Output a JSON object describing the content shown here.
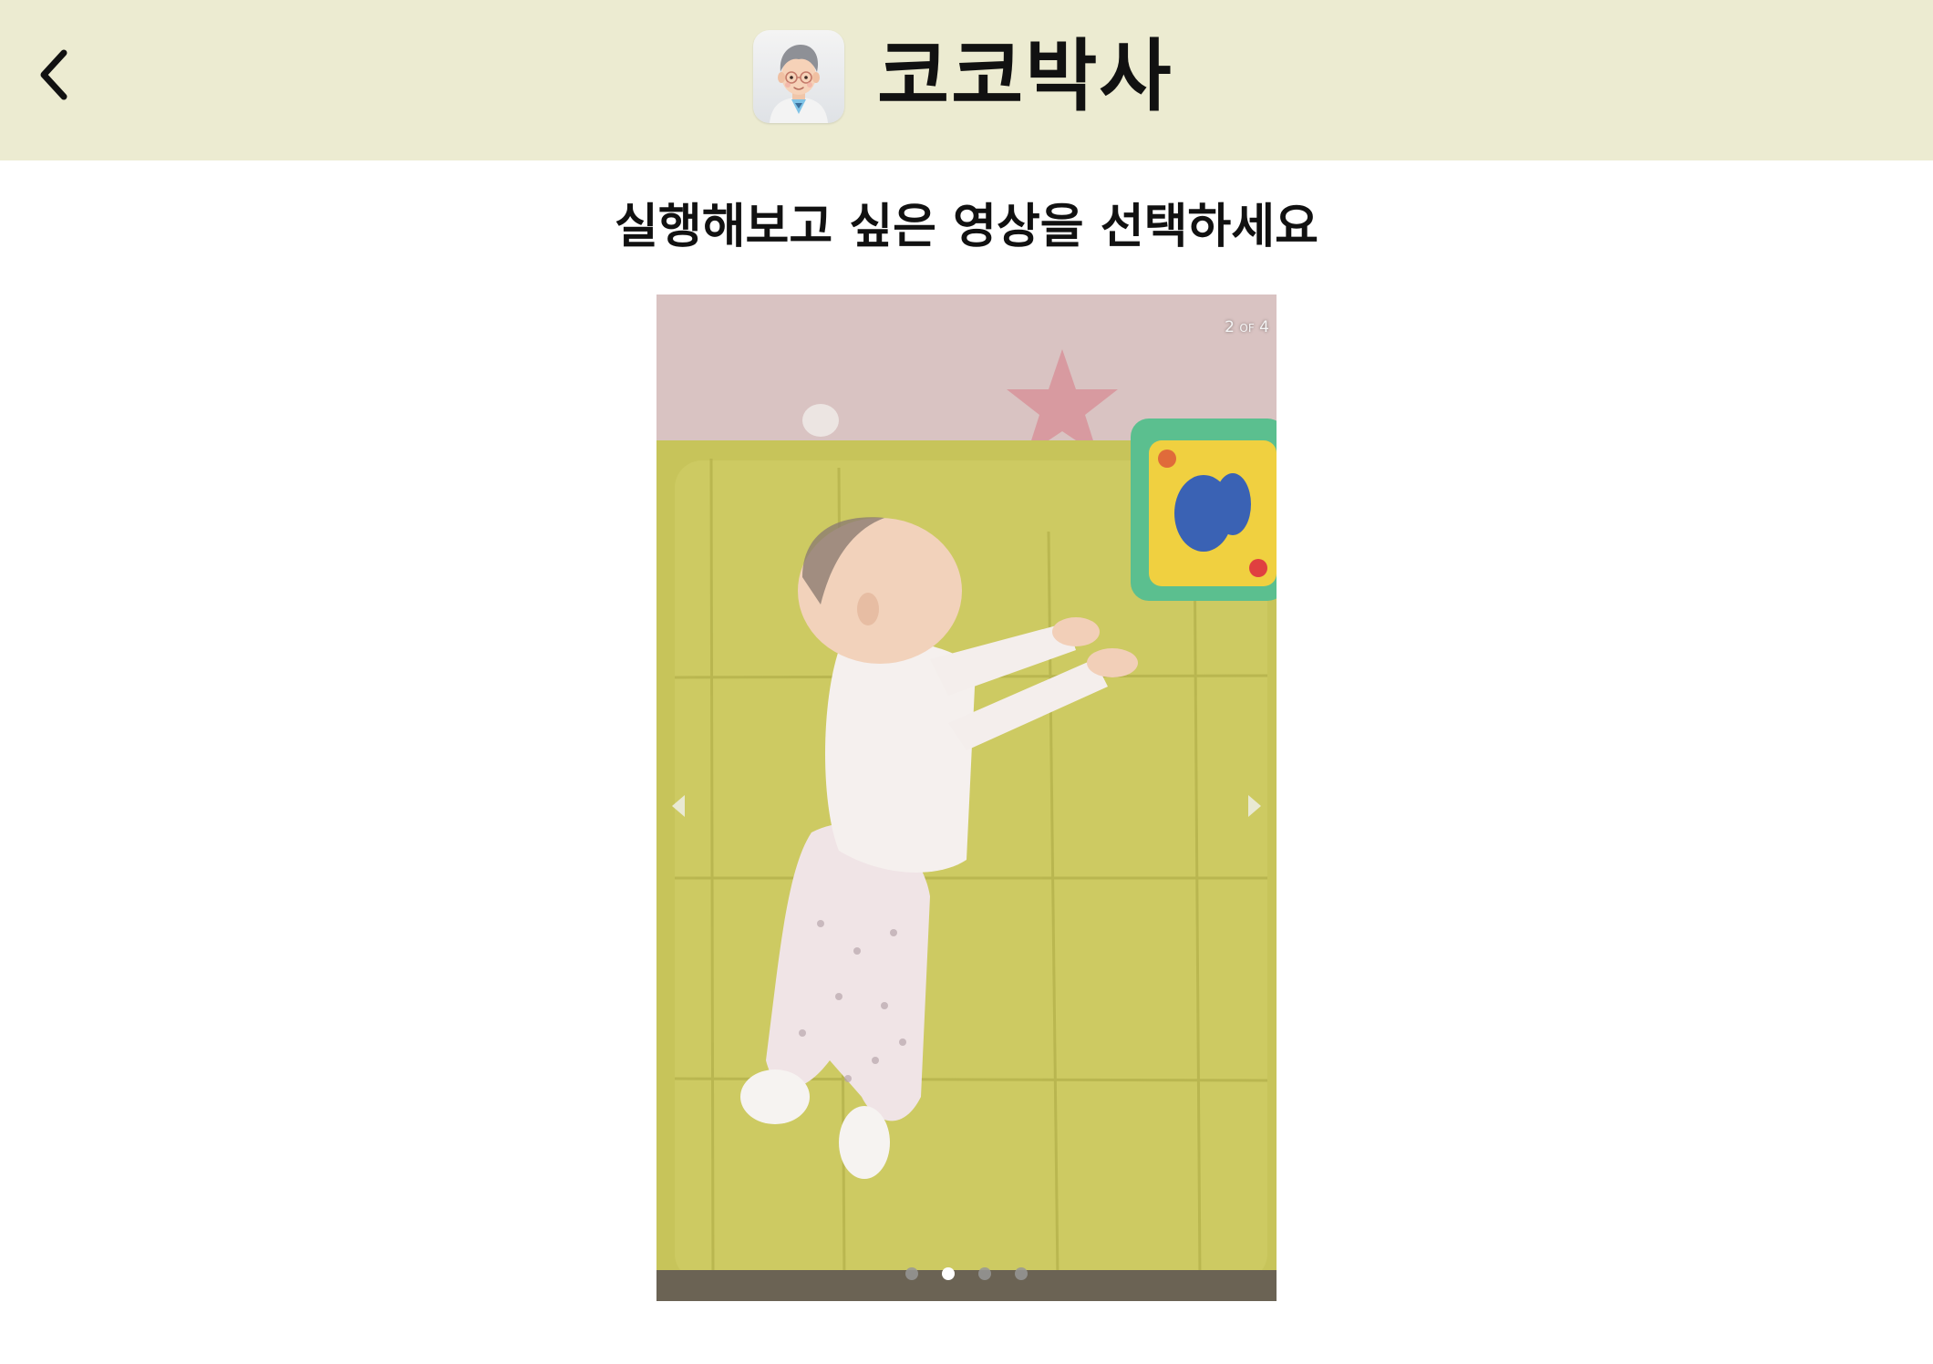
{
  "header": {
    "app_name": "코코박사",
    "back_icon": "chevron-left-icon",
    "logo": "doctor-avatar-logo",
    "background": "#ecebd1"
  },
  "main": {
    "heading": "실행해보고 싶은 영상을 선택하세요"
  },
  "carousel": {
    "current": "2",
    "of": "OF",
    "total": "4",
    "active_index": 1,
    "slide_count": 4,
    "prev_icon": "triangle-left-icon",
    "next_icon": "triangle-right-icon",
    "slide_content": "video thumbnail: baby lying on green mat"
  }
}
